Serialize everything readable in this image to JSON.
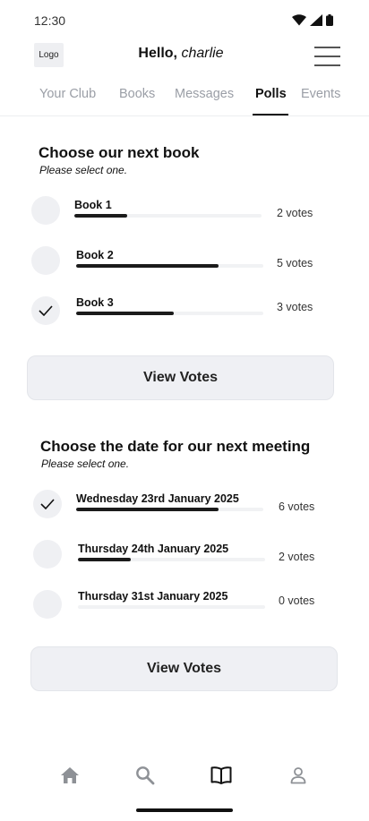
{
  "status_bar": {
    "time": "12:30"
  },
  "header": {
    "logo_text": "Logo",
    "greeting_prefix": "Hello,",
    "user_name": "charlie"
  },
  "tabs": [
    {
      "label": "Your  Club",
      "active": false
    },
    {
      "label": "Books",
      "active": false
    },
    {
      "label": "Messages",
      "active": false
    },
    {
      "label": "Polls",
      "active": true
    },
    {
      "label": "Events",
      "active": false
    }
  ],
  "polls": [
    {
      "title": "Choose our next book",
      "subtitle": "Please select one.",
      "options": [
        {
          "label": "Book 1",
          "votes_text": "2 votes",
          "fill_fraction": 0.28,
          "selected": false
        },
        {
          "label": "Book 2",
          "votes_text": "5 votes",
          "fill_fraction": 0.76,
          "selected": false
        },
        {
          "label": "Book 3",
          "votes_text": "3 votes",
          "fill_fraction": 0.52,
          "selected": true
        }
      ],
      "button_label": "View Votes"
    },
    {
      "title": "Choose the date for our next meeting",
      "subtitle": "Please select one.",
      "options": [
        {
          "label": "Wednesday 23rd January 2025",
          "votes_text": "6 votes",
          "fill_fraction": 0.76,
          "selected": true
        },
        {
          "label": "Thursday 24th January 2025",
          "votes_text": "2 votes",
          "fill_fraction": 0.28,
          "selected": false
        },
        {
          "label": "Thursday 31st January 2025",
          "votes_text": "0 votes",
          "fill_fraction": 0.0,
          "selected": false
        }
      ],
      "button_label": "View Votes"
    }
  ],
  "bottom_nav": [
    {
      "icon": "home-icon",
      "active": false
    },
    {
      "icon": "search-icon",
      "active": false
    },
    {
      "icon": "book-open-icon",
      "active": true
    },
    {
      "icon": "user-icon",
      "active": false
    }
  ],
  "colors": {
    "fill": "#1b1b1b",
    "track": "#f1f2f4",
    "button_bg": "#eff0f4",
    "inactive_tab": "#9a9ea6"
  }
}
